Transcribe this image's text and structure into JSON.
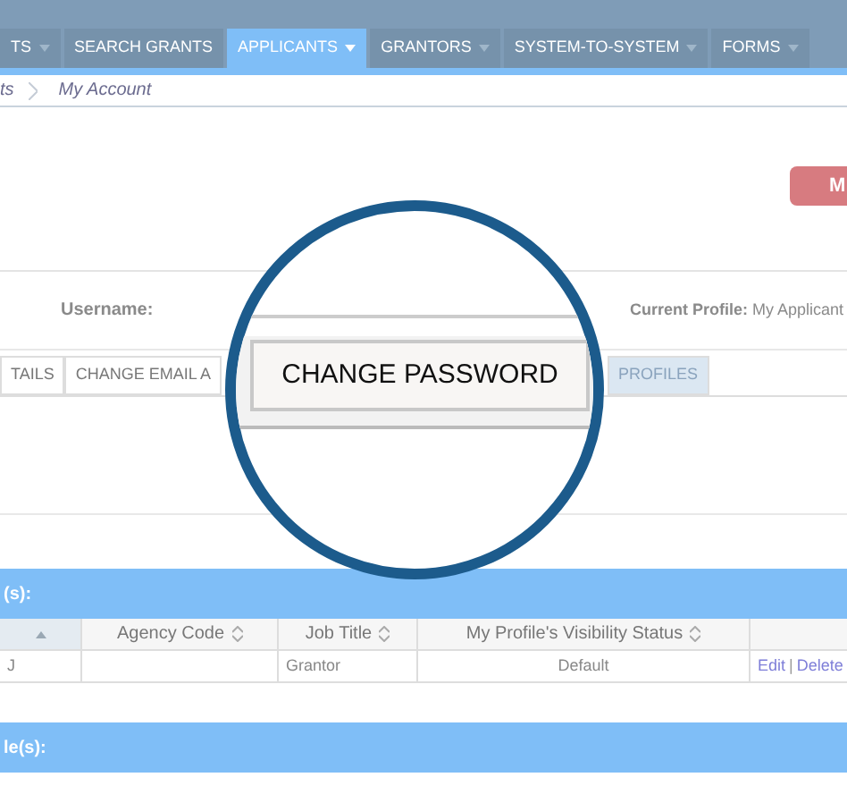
{
  "nav": [
    {
      "label": "TS",
      "selected": false,
      "dropdown": true
    },
    {
      "label": "SEARCH GRANTS",
      "selected": false,
      "dropdown": false
    },
    {
      "label": "APPLICANTS",
      "selected": true,
      "dropdown": true
    },
    {
      "label": "GRANTORS",
      "selected": false,
      "dropdown": true
    },
    {
      "label": "SYSTEM-TO-SYSTEM",
      "selected": false,
      "dropdown": true
    },
    {
      "label": "FORMS",
      "selected": false,
      "dropdown": true
    }
  ],
  "breadcrumb": [
    "ts",
    "My Account"
  ],
  "action_button": "M",
  "account": {
    "username_label": "Username:",
    "current_profile": "**Current Profile:** My Applicant"
  },
  "tabs": [
    {
      "label": "TAILS",
      "selected": false
    },
    {
      "label": "CHANGE EMAIL A",
      "selected": false
    },
    {
      "label": "PROFILES",
      "selected": true
    }
  ],
  "magnifier": {
    "tab": {
      "label": "CHANGE PASSWORD",
      "selected": true
    }
  },
  "sections": [
    {
      "title": "(s):",
      "table": {
        "columns": [
          {
            "sortable": true,
            "sorted": true
          },
          {
            "label": "Agency Code",
            "sortable": true,
            "sorted": false
          },
          {
            "label": "Job Title",
            "sortable": true,
            "sorted": false
          },
          {
            "label": "My Profile's Visibility Status",
            "sortable": true,
            "sorted": false
          },
          {
            "sortable": false,
            "sorted": false
          }
        ],
        "rows": [
          {
            "cells": [
              "J",
              "",
              "Grantor",
              "Default"
            ],
            "actions": [
              "Edit",
              "|",
              "Delete"
            ]
          }
        ]
      }
    },
    {
      "title": "le(s):"
    }
  ]
}
